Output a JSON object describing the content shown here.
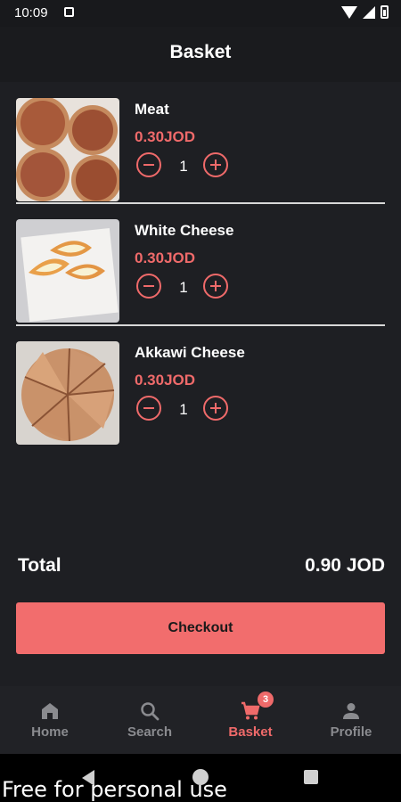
{
  "status_bar": {
    "time": "10:09"
  },
  "header": {
    "title": "Basket"
  },
  "items": [
    {
      "name": "Meat",
      "price": "0.30JOD",
      "quantity": "1"
    },
    {
      "name": "White Cheese",
      "price": "0.30JOD",
      "quantity": "1"
    },
    {
      "name": "Akkawi Cheese",
      "price": "0.30JOD",
      "quantity": "1"
    }
  ],
  "total": {
    "label": "Total",
    "value": "0.90 JOD"
  },
  "checkout": {
    "label": "Checkout"
  },
  "nav": {
    "items": [
      {
        "label": "Home",
        "icon": "home-icon"
      },
      {
        "label": "Search",
        "icon": "search-icon"
      },
      {
        "label": "Basket",
        "icon": "cart-icon",
        "badge": "3",
        "active": true
      },
      {
        "label": "Profile",
        "icon": "person-icon"
      }
    ]
  },
  "watermark": "Free for personal use",
  "colors": {
    "accent": "#ef6a6a",
    "background": "#1e1f23",
    "checkout_bg": "#f26d6d"
  }
}
